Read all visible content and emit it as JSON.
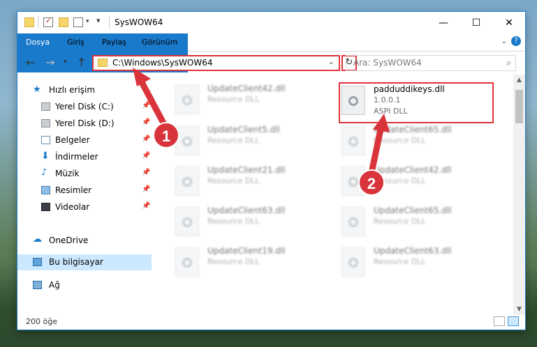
{
  "window": {
    "title": "SysWOW64"
  },
  "titlebar": {
    "minimize": "—",
    "maximize": "☐",
    "close": "✕"
  },
  "ribbon": {
    "tabs": [
      "Dosya",
      "Giriş",
      "Paylaş",
      "Görünüm"
    ]
  },
  "navbar": {
    "address": "C:\\Windows\\SysWOW64",
    "search_placeholder": "Ara: SysWOW64"
  },
  "sidebar": {
    "quick_access": "Hızlı erişim",
    "items": [
      {
        "label": "Yerel Disk (C:)"
      },
      {
        "label": "Yerel Disk (D:)"
      },
      {
        "label": "Belgeler"
      },
      {
        "label": "İndirmeler"
      },
      {
        "label": "Müzik"
      },
      {
        "label": "Resimler"
      },
      {
        "label": "Videolar"
      }
    ],
    "onedrive": "OneDrive",
    "this_pc": "Bu bilgisayar",
    "network": "Ağ"
  },
  "files": {
    "highlighted": {
      "name": "padduddikeys.dll",
      "version": "1.0.0.1",
      "description": "ASPI DLL"
    },
    "left_column": [
      {
        "name": "UpdateClient42.dll",
        "description": "Resource DLL"
      },
      {
        "name": "UpdateClient5.dll",
        "description": "Resource DLL"
      },
      {
        "name": "UpdateClient21.dll",
        "description": "Resource DLL"
      },
      {
        "name": "UpdateClient63.dll",
        "description": "Resource DLL"
      },
      {
        "name": "UpdateClient19.dll",
        "description": "Resource DLL"
      }
    ],
    "right_column": [
      {
        "name": "UpdateClient65.dll",
        "description": "Resource DLL"
      },
      {
        "name": "UpdateClient42.dll",
        "description": "Resource DLL"
      },
      {
        "name": "UpdateClient65.dll",
        "description": "Resource DLL"
      },
      {
        "name": "UpdateClient63.dll",
        "description": "Resource DLL"
      }
    ]
  },
  "status": {
    "item_count": "200 öğe"
  },
  "annotations": {
    "badge1": "1",
    "badge2": "2"
  },
  "colors": {
    "accent": "#1979ca",
    "callout": "#d9343b"
  }
}
